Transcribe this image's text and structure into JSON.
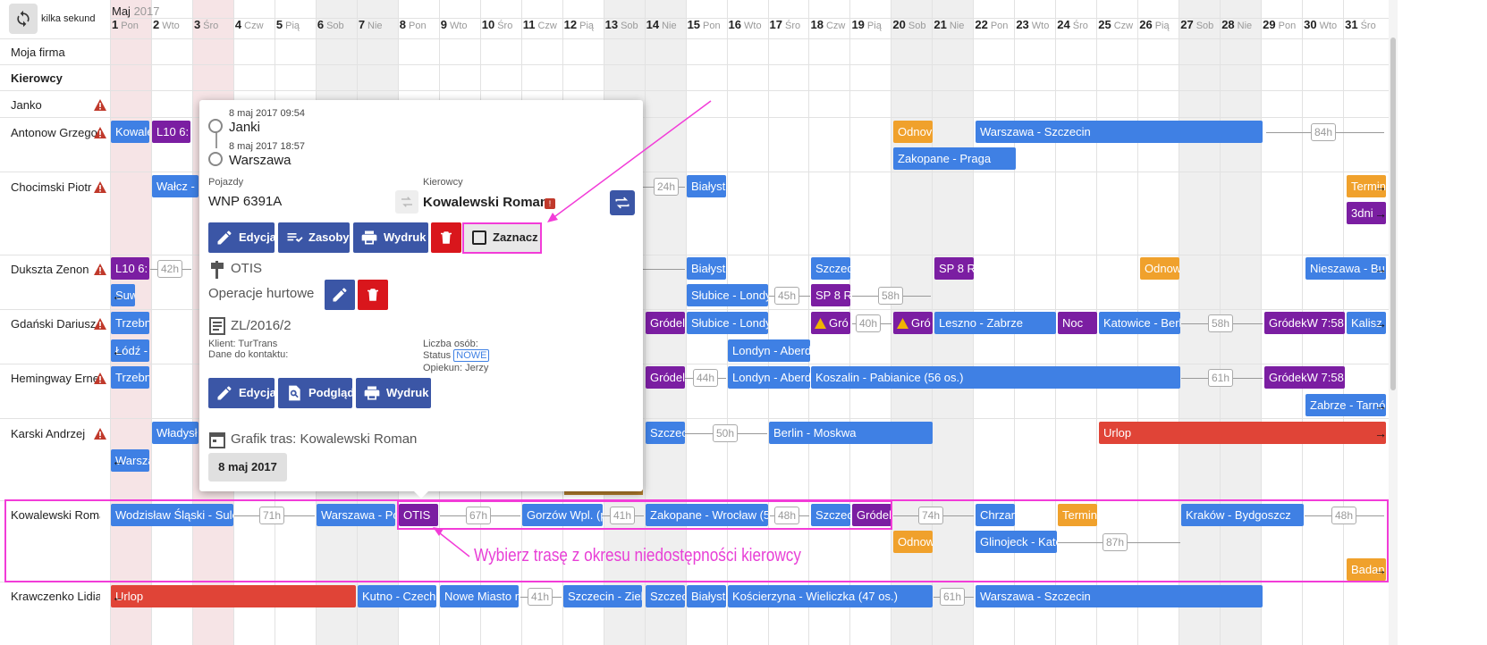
{
  "header": {
    "refresh_label": "kilka sekund",
    "month": "Maj",
    "year": "2017"
  },
  "days": [
    [
      "1",
      "Pon"
    ],
    [
      "2",
      "Wto"
    ],
    [
      "3",
      "Śro"
    ],
    [
      "4",
      "Czw"
    ],
    [
      "5",
      "Pią"
    ],
    [
      "6",
      "Sob"
    ],
    [
      "7",
      "Nie"
    ],
    [
      "8",
      "Pon"
    ],
    [
      "9",
      "Wto"
    ],
    [
      "10",
      "Śro"
    ],
    [
      "11",
      "Czw"
    ],
    [
      "12",
      "Pią"
    ],
    [
      "13",
      "Sob"
    ],
    [
      "14",
      "Nie"
    ],
    [
      "15",
      "Pon"
    ],
    [
      "16",
      "Wto"
    ],
    [
      "17",
      "Śro"
    ],
    [
      "18",
      "Czw"
    ],
    [
      "19",
      "Pią"
    ],
    [
      "20",
      "Sob"
    ],
    [
      "21",
      "Nie"
    ],
    [
      "22",
      "Pon"
    ],
    [
      "23",
      "Wto"
    ],
    [
      "24",
      "Śro"
    ],
    [
      "25",
      "Czw"
    ],
    [
      "26",
      "Pią"
    ],
    [
      "27",
      "Sob"
    ],
    [
      "28",
      "Nie"
    ],
    [
      "29",
      "Pon"
    ],
    [
      "30",
      "Wto"
    ],
    [
      "31",
      "Śro"
    ]
  ],
  "rows": {
    "company": "Moja firma",
    "group": "Kierowcy",
    "drivers": [
      "Janko",
      "Antonow Grzegorz",
      "Chocimski Piotr",
      "Dukszta Zenon",
      "Gdański Dariusz",
      "Hemingway Ernest",
      "Karski Andrzej",
      "Kowalewski Roman",
      "Krawczenko Lidia"
    ]
  },
  "blocks": [
    "Kowalewski",
    "L10 6:",
    "Odnov",
    "Warszawa - Szczecin",
    "Zakopane - Praga",
    "Wałcz -",
    "Białyst",
    "Termin",
    "3dni",
    "L10 6:",
    "Białyst",
    "Szczec",
    "SP 8 R",
    "Odnow",
    "Nieszawa - Bu",
    "Suw",
    "Słubice - Londy",
    "SP 8 R",
    "Trzebn",
    "Gródel",
    "Słubice - Londy",
    "Gró",
    "Gró",
    "Leszno - Zabrze",
    "Noc",
    "Katowice - Berl",
    "GródekW 7:58",
    "Kalisz",
    "Łódź -",
    "Londyn - Aberd",
    "Trzebn",
    "Gródel",
    "Londyn - Aberd",
    "Koszalin - Pabianice (56 os.)",
    "GródekW 7:58",
    "Zabrze - Tarnó",
    "Władysł",
    "Szczec",
    "Berlin - Moskwa",
    "Urlop",
    "Warsza",
    "Wodzisław Śląski - Sulejó",
    "Warszawa - Poz",
    "OTIS",
    "Gorzów Wpl. (p",
    "Zakopane - Wrocław (59",
    "Szczec",
    "Gródel",
    "Chrzar",
    "Termin",
    "Kraków - Bydgoszcz",
    "Odnow",
    "Glinojeck - Kato",
    "Badan",
    "Urlop",
    "Kutno - Czecho",
    "Nowe Miasto n",
    "Szczecin - Zielo",
    "Szczec",
    "Białyst",
    "Kościerzyna - Wieliczka (47 os.)",
    "Warszawa - Szczecin"
  ],
  "gaps": [
    "84h",
    "24h",
    "42h",
    "45h",
    "58h",
    "40h",
    "58h",
    "44h",
    "61h",
    "50h",
    "71h",
    "67h",
    "41h",
    "48h",
    "74h",
    "48h",
    "87h",
    "41h",
    "61h"
  ],
  "popup": {
    "start_time": "8 maj 2017 09:54",
    "start_place": "Janki",
    "end_time": "8 maj 2017 18:57",
    "end_place": "Warszawa",
    "vehicles_label": "Pojazdy",
    "vehicle": "WNP 6391A",
    "drivers_label": "Kierowcy",
    "driver": "Kowalewski Roman",
    "btn_edit": "Edycja",
    "btn_resources": "Zasoby",
    "btn_print": "Wydruk",
    "btn_select": "Zaznacz",
    "op_name": "OTIS",
    "op_type": "Operacje hurtowe",
    "order_no": "ZL/2016/2",
    "client": "Klient: TurTrans",
    "contact": "Dane do kontaktu:",
    "persons": "Liczba osób:",
    "status_label": "Status",
    "status": "NOWE",
    "guardian": "Opiekun: Jerzy",
    "btn_edit2": "Edycja",
    "btn_preview": "Podgląd",
    "btn_print2": "Wydruk",
    "schedule": "Grafik tras: Kowalewski Roman",
    "date_btn": "8 maj 2017"
  },
  "annotation": "Wybierz trasę z okresu niedostępności kierowcy",
  "colors": {
    "blue": "#3f80e4",
    "purple": "#7b1ea2",
    "orange": "#f0a12c",
    "red": "#e04437",
    "accent": "#3b56a6",
    "highlight": "#f23cd8"
  }
}
